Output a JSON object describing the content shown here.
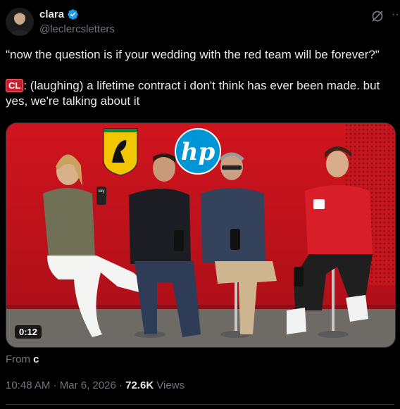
{
  "author": {
    "name": "clara",
    "handle": "@leclercsletters"
  },
  "tweet": {
    "line1": "\"now the question is if your wedding with the red team will be forever?\"",
    "badge": "CL",
    "line2": ": (laughing) a lifetime contract i don't think has ever been made. but yes, we're talking about it"
  },
  "media": {
    "duration": "0:12",
    "sponsor_text": "hp",
    "mic_text": "sky"
  },
  "source": {
    "prefix": "From",
    "name": "c"
  },
  "meta": {
    "time": "10:48 AM",
    "separator": "·",
    "date": "Mar 6, 2026",
    "views": "72.6K",
    "views_label": "Views"
  },
  "colors": {
    "background": "#000000",
    "primary_text": "#e7e9ea",
    "secondary_text": "#71767b",
    "verified": "#1d9bf0",
    "ferrari_red": "#c8121d"
  },
  "icons": [
    "verified-badge-icon",
    "grok-icon",
    "more-options-icon"
  ]
}
